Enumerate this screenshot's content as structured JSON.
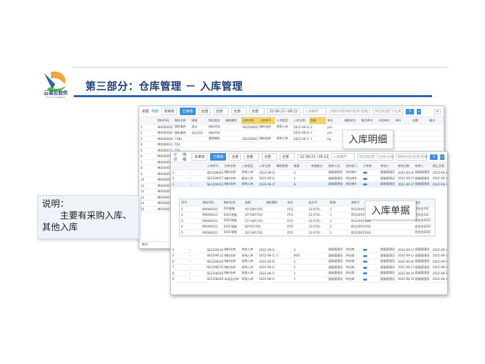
{
  "slide": {
    "logo_text": "云易云软件",
    "logo_sub": "YunYi Yun Software",
    "title": "第三部分：仓库管理 － 入库管理",
    "note_line1": "说明：",
    "note_line2": "主要有采购入库、",
    "note_line3": "其他入库",
    "label_detail": "入库明细",
    "label_doc": "入库单据"
  },
  "win1": {
    "toolbar": {
      "view1": "单据",
      "view2": "明细",
      "tab1": "未审核",
      "tab2": "已审核",
      "tab3": "全部",
      "sel1": "全部",
      "sel2": "全部",
      "sel3": "全部",
      "date": "22-06-21~06-21",
      "inp1": "入库编号",
      "inp2": "物料代码/物料名称/规格",
      "inp3": "供应商/部门/仓库",
      "menu": "≡"
    },
    "columns": [
      "",
      "物料代码",
      "物料名称",
      "规格",
      "物料类别",
      "辅助属性",
      "仓库名称",
      "入库单号",
      "入库类型",
      "入库日期",
      "数量",
      "单位",
      "辅助单位",
      "备用单位",
      "计划单位",
      "单价",
      "金额",
      "备注"
    ],
    "rows": [
      [
        "1",
        "M0000002",
        "塑料事件",
        "显示",
        "材料代码",
        "",
        "SE22090020001",
        "物料仓库",
        "采购入库",
        "2022-09-20",
        "2",
        "pcs",
        "",
        "",
        "",
        "",
        "",
        ""
      ],
      [
        "2",
        "M0000002",
        "塑料事件",
        "显示222",
        "材料代码",
        "",
        "",
        "",
        "",
        "2022-09-20",
        "1",
        "pcs",
        "",
        "",
        "",
        "",
        "",
        ""
      ],
      [
        "3",
        "M0000004",
        "73B4",
        "",
        "通用物料",
        "",
        "SE22090170002",
        "物料仓库",
        "采购入库",
        "2022-09-17",
        "1",
        "kg",
        "",
        "",
        "",
        "",
        "",
        ""
      ],
      [
        "4",
        "M0000012",
        "550",
        "",
        "",
        "",
        "",
        "",
        "",
        "",
        "",
        "",
        "",
        "",
        "",
        "",
        "",
        ""
      ],
      [
        "5",
        "M0000012",
        "550",
        "",
        "",
        "",
        "",
        "",
        "",
        "",
        "",
        "",
        "",
        "",
        "",
        "",
        "",
        ""
      ],
      [
        "6",
        "M0000012",
        "550",
        "",
        "",
        "",
        "",
        "",
        "",
        "",
        "",
        "",
        "",
        "",
        "",
        "",
        "",
        ""
      ],
      [
        "7",
        "M0000010",
        "P20",
        "",
        "",
        "",
        "",
        "",
        "",
        "",
        "",
        "",
        "",
        "",
        "",
        "",
        "",
        ""
      ],
      [
        "8",
        "M0000010",
        "P20",
        "",
        "",
        "",
        "",
        "",
        "",
        "",
        "",
        "",
        "",
        "",
        "",
        "",
        "",
        ""
      ],
      [
        "9",
        "M0000012",
        "550",
        "",
        "",
        "",
        "",
        "",
        "",
        "",
        "",
        "",
        "",
        "",
        "",
        "",
        "",
        ""
      ],
      [
        "10",
        "M0000008",
        "E92",
        "",
        "",
        "",
        "",
        "",
        "",
        "",
        "",
        "",
        "",
        "",
        "",
        "",
        "",
        ""
      ],
      [
        "11",
        "M0000015",
        "内小",
        "",
        "",
        "",
        "",
        "",
        "",
        "",
        "",
        "",
        "",
        "",
        "",
        "",
        "",
        ""
      ],
      [
        "12",
        "M0000018",
        "透明",
        "",
        "",
        "",
        "",
        "",
        "",
        "",
        "",
        "",
        "",
        "",
        "",
        "",
        "",
        ""
      ],
      [
        "13",
        "M0000010",
        "P20",
        "",
        "",
        "",
        "",
        "",
        "",
        "",
        "",
        "",
        "",
        "",
        "",
        "",
        "",
        ""
      ],
      [
        "14",
        "M0000004",
        "73B",
        "",
        "",
        "",
        "",
        "",
        "",
        "",
        "",
        "",
        "",
        "",
        "",
        "",
        "",
        ""
      ],
      [
        "15",
        "M0000016",
        "xCll",
        "",
        "",
        "",
        "",
        "",
        "",
        "",
        "",
        "",
        "",
        "",
        "",
        "",
        "",
        ""
      ]
    ],
    "status": "统计"
  },
  "win2": {
    "toolbar": {
      "view1": "单据",
      "view2": "明细",
      "tab1": "未审核",
      "tab2": "已审核",
      "tab3": "全部",
      "sel1": "全部",
      "sel2": "全部",
      "sel3": "全部",
      "date": "22-06-21~06-21",
      "inp1": "入库编号",
      "inp2": "供应商/部门/仓库/仓库",
      "inp3": "物料代码/名称/规格"
    },
    "columns": [
      "",
      "",
      "入库单号",
      "仓库名称",
      "入库类型",
      "入库日期",
      "辅助数量",
      "数量",
      "单据备注",
      "相关人员",
      "相关部门",
      "已审核",
      "审核人",
      "审核日期",
      "制单人",
      "建立日期"
    ],
    "rows_top": [
      [
        "1",
        "›",
        "SE22090200001",
        "物料仓库",
        "采购入库",
        "2022-09-20",
        "",
        "2",
        "",
        "超级管理员",
        "供应商A",
        "●",
        "超级管理员",
        "2022-09-20",
        "超级管理员",
        "2022-09-20 15:23:48"
      ],
      [
        "2",
        "›",
        "SE22090170002",
        "物料仓库",
        "维修入库",
        "2022-09-17",
        "",
        "1",
        "",
        "超级管理员",
        "供应商B",
        "●",
        "超级管理员",
        "2022-09-17",
        "超级管理员",
        "2022-09-17 14:06:06"
      ],
      [
        "3",
        "⌄",
        "SE22090150001",
        "物料仓库",
        "采购入库",
        "2022-09-15",
        "",
        "8",
        "",
        "超级管理员",
        "供应商A",
        "●",
        "超级管理员",
        "2022-09-15",
        "超级管理员",
        "2022-09-15 14:09:43"
      ]
    ],
    "sub_columns": [
      "序号",
      "物料代码",
      "物料名称",
      "规格",
      "辅助属性",
      "单位",
      "批次号",
      "数量",
      "源单号",
      "已审核",
      "相关单据",
      "备注"
    ],
    "sub_rows": [
      [
        "1",
        "M0000010",
        "P20塑胶",
        "45*280*250",
        "",
        "PCS",
        "22-07S/...",
        "1",
        "PO2209150001",
        "",
        "",
        "铝合金20C"
      ],
      [
        "2",
        "M0000012",
        "S50C塑胶",
        "25*280*250",
        "",
        "PCS",
        "22-07S/...",
        "1",
        "PO2209150001",
        "",
        "",
        "铝合金20C"
      ],
      [
        "3",
        "M0000012",
        "S50C塑胶",
        "15*140*250",
        "",
        "PCS",
        "22-07S/...",
        "1",
        "PO2209150001",
        "",
        "",
        "铝合金S50C"
      ],
      [
        "4",
        "M0000012",
        "S50C塑胶",
        "60*40*250",
        "",
        "PCS",
        "22-07S/...",
        "2",
        "PO2209150001",
        "",
        "",
        "铝合金S50C"
      ],
      [
        "5",
        "M0000012",
        "S50C塑胶",
        "20*140*250",
        "",
        "PCS",
        "22-07S/...",
        "2",
        "PO2209150001",
        "",
        "",
        "铝合金S50C"
      ]
    ],
    "rows_bottom": [
      [
        "4",
        "›",
        "SE22091300001",
        "物料仓库",
        "其他入库",
        "2022-09-13",
        "",
        "2",
        "",
        "超级管理员",
        "供应商",
        "●",
        "超级管理员",
        "2022-09-13",
        "超级管理员",
        "2022-09-13 15:10:06"
      ],
      [
        "5",
        "›",
        "SE22091120002",
        "物料仓库",
        "采购入库",
        "2022-09-13",
        "2",
        "ASD",
        "",
        "超级管理员",
        "供应商",
        "●",
        "超级管理员",
        "2022-09-13",
        "超级管理员",
        "2022-09-13 15:14:54"
      ],
      [
        "6",
        "›",
        "SE22090500001",
        "物料仓库",
        "采购入库",
        "2022-09-05",
        "",
        "1",
        "",
        "超级管理员",
        "供应商",
        "●",
        "超级管理员",
        "2022-09-05",
        "超级管理员",
        "2022-09-07 14:23:16"
      ],
      [
        "7",
        "›",
        "SE22082700001",
        "物料仓库",
        "采购入库",
        "2022-08-27",
        "",
        "1",
        "",
        "超级管理员",
        "供应商",
        "●",
        "超级管理员",
        "2022-08-27",
        "超级管理员",
        "2022-08-27 11:34:09"
      ],
      [
        "8",
        "›",
        "SE22082400003",
        "物料仓库",
        "其他入库",
        "2022-08-24",
        "",
        "1",
        "",
        "超级管理员",
        "供应商",
        "●",
        "超级管理员",
        "2022-08-24",
        "超级管理员",
        "2022-08-24 14:25:09"
      ],
      [
        "9",
        "›",
        "SE22082400002",
        "半成品仓库",
        "采购入库",
        "2022-08-24",
        "",
        "1",
        "",
        "超级管理员",
        "供应商",
        "●",
        "超级管理员",
        "2022-08-24",
        "超级管理员",
        "2022-08-24 14:18:34"
      ]
    ]
  },
  "colors": {
    "accent": "#3f8ee0",
    "title": "#1d3f78",
    "header_highlight": "#f3d46b"
  }
}
